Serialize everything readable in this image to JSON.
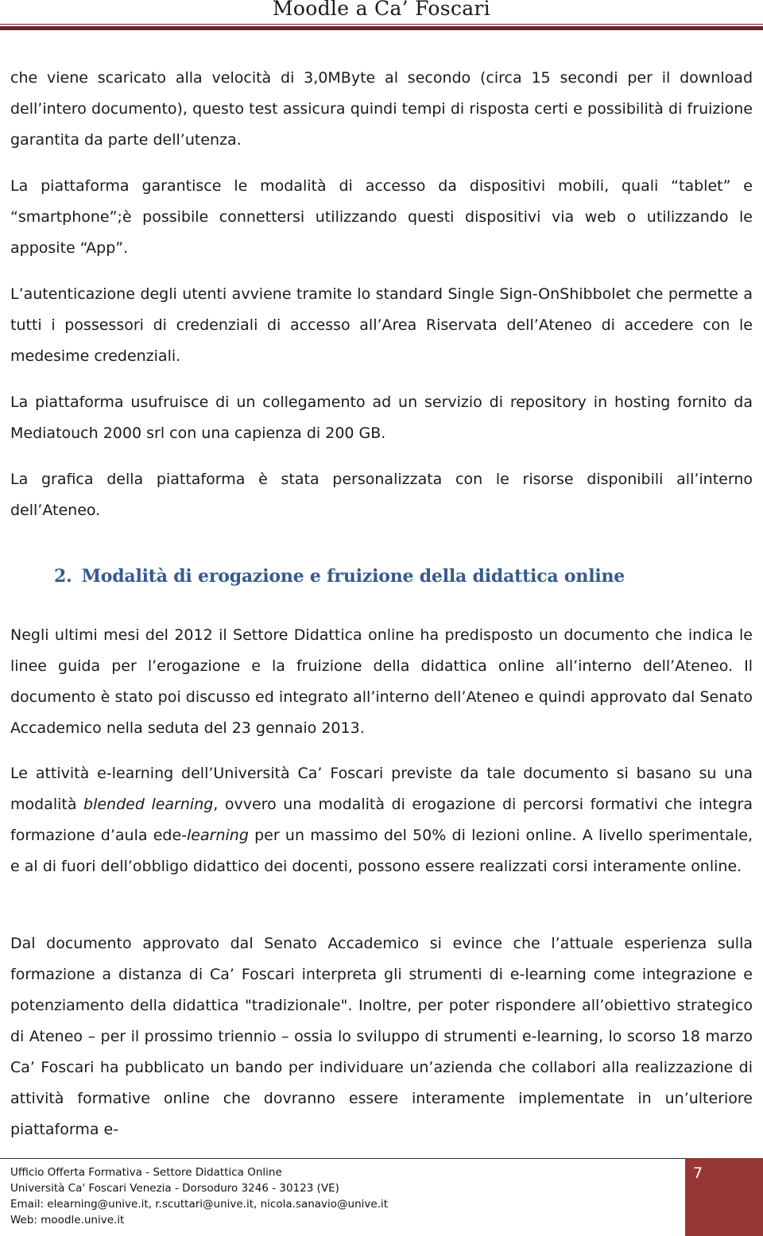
{
  "header": {
    "title": "Moodle a Ca’ Foscari"
  },
  "paragraphs": {
    "p1": "che viene scaricato alla velocità di 3,0MByte al secondo (circa 15 secondi per il download dell’intero documento), questo test assicura quindi tempi di risposta certi e possibilità di fruizione garantita da parte dell’utenza.",
    "p2": "La piattaforma garantisce le modalità di accesso da dispositivi mobili, quali “tablet” e “smartphone”;è possibile connettersi utilizzando questi dispositivi via web o utilizzando le apposite “App”.",
    "p3": "L’autenticazione degli utenti avviene tramite lo standard Single Sign-OnShibbolet che permette a tutti i possessori di credenziali di accesso all’Area Riservata dell’Ateneo di accedere con le medesime credenziali.",
    "p4": "La piattaforma usufruisce di un collegamento ad un servizio di repository in hosting fornito da Mediatouch 2000 srl con una capienza di 200 GB.",
    "p5": "La grafica della piattaforma è stata personalizzata con le risorse disponibili all’interno dell’Ateneo."
  },
  "section": {
    "number": "2.",
    "title": "Modalità di erogazione e fruizione della didattica online"
  },
  "section_paragraphs": {
    "p6": "Negli ultimi mesi del 2012 il Settore Didattica online ha predisposto un documento che indica le linee guida per l’erogazione e la fruizione della didattica online all’interno dell’Ateneo. Il documento è stato poi discusso ed integrato all’interno dell’Ateneo e quindi approvato dal Senato Accademico nella seduta del 23 gennaio 2013.",
    "p7": {
      "part1": "Le attività e-learning dell’Università Ca’ Foscari previste da tale documento si basano su una modalità ",
      "italic1": "blended learning",
      "part2": ", ovvero una modalità di erogazione di percorsi formativi che integra formazione d’aula ede",
      "italic2": "-learning",
      "part3": " per un massimo del 50% di lezioni online. A livello sperimentale, e al di fuori dell’obbligo didattico dei docenti, possono essere realizzati corsi interamente online."
    },
    "p8": "Dal documento approvato dal Senato Accademico si evince che l’attuale esperienza sulla formazione a distanza di Ca’ Foscari interpreta gli strumenti di e-learning come integrazione e potenziamento della didattica \"tradizionale\". Inoltre, per poter rispondere all’obiettivo strategico di Ateneo – per il prossimo triennio – ossia lo sviluppo di strumenti e-learning, lo scorso 18 marzo Ca’ Foscari ha pubblicato un bando per individuare un’azienda che collabori alla realizzazione di attività formative online che dovranno essere interamente implementate in un’ulteriore piattaforma e-"
  },
  "footer": {
    "line1": "Ufficio Offerta Formativa - Settore Didattica Online",
    "line2": "Università Ca' Foscari Venezia - Dorsoduro 3246 - 30123 (VE)",
    "line3": "Email: elearning@unive.it, r.scuttari@unive.it, nicola.sanavio@unive.it",
    "line4": "Web: moodle.unive.it",
    "page_number": "7"
  },
  "colors": {
    "header_rule": "#6b2424",
    "heading": "#355b8c",
    "page_box": "#963735"
  }
}
